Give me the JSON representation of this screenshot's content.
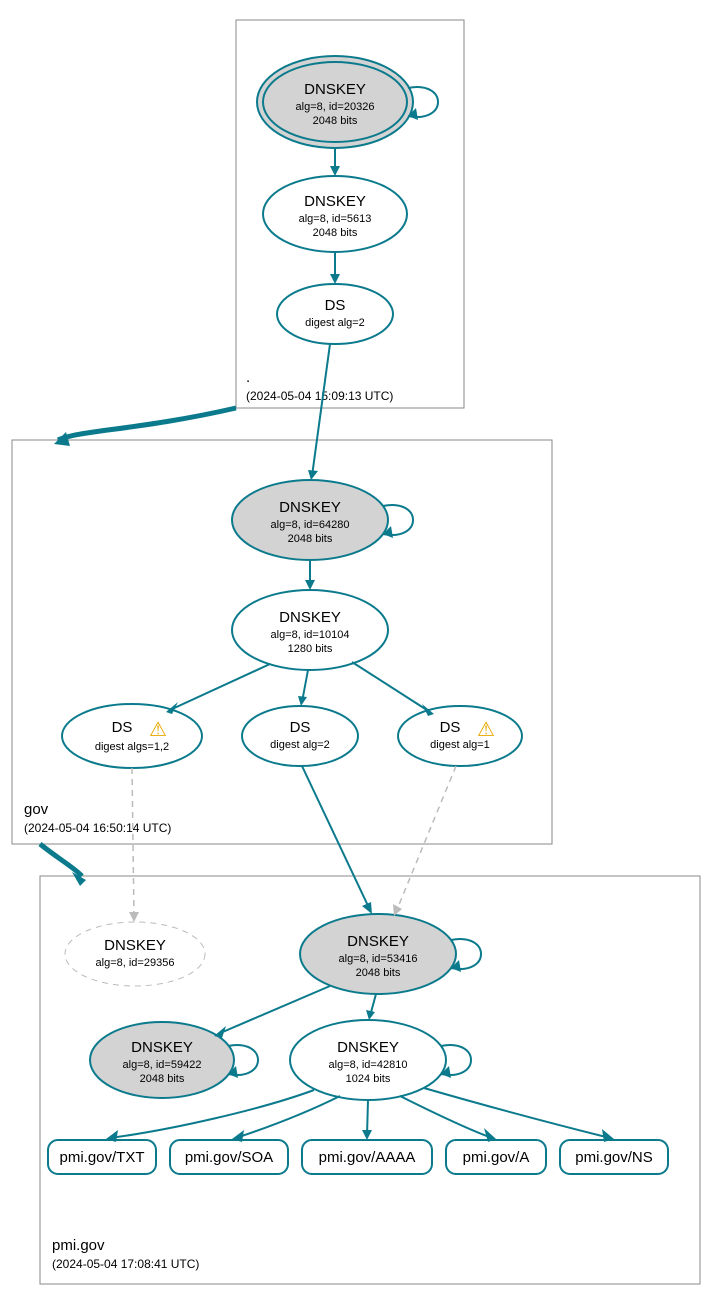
{
  "zones": {
    "root": {
      "label": ".",
      "timestamp": "(2024-05-04 15:09:13 UTC)",
      "ksk": {
        "title": "DNSKEY",
        "sub1": "alg=8, id=20326",
        "sub2": "2048 bits"
      },
      "zsk": {
        "title": "DNSKEY",
        "sub1": "alg=8, id=5613",
        "sub2": "2048 bits"
      },
      "ds": {
        "title": "DS",
        "sub1": "digest alg=2"
      }
    },
    "gov": {
      "label": "gov",
      "timestamp": "(2024-05-04 16:50:14 UTC)",
      "ksk": {
        "title": "DNSKEY",
        "sub1": "alg=8, id=64280",
        "sub2": "2048 bits"
      },
      "zsk": {
        "title": "DNSKEY",
        "sub1": "alg=8, id=10104",
        "sub2": "1280 bits"
      },
      "ds1": {
        "title": "DS",
        "sub1": "digest algs=1,2"
      },
      "ds2": {
        "title": "DS",
        "sub1": "digest alg=2"
      },
      "ds3": {
        "title": "DS",
        "sub1": "digest alg=1"
      }
    },
    "pmi": {
      "label": "pmi.gov",
      "timestamp": "(2024-05-04 17:08:41 UTC)",
      "missing": {
        "title": "DNSKEY",
        "sub1": "alg=8, id=29356"
      },
      "ksk": {
        "title": "DNSKEY",
        "sub1": "alg=8, id=53416",
        "sub2": "2048 bits"
      },
      "key2": {
        "title": "DNSKEY",
        "sub1": "alg=8, id=59422",
        "sub2": "2048 bits"
      },
      "zsk": {
        "title": "DNSKEY",
        "sub1": "alg=8, id=42810",
        "sub2": "1024 bits"
      },
      "rrsets": {
        "txt": "pmi.gov/TXT",
        "soa": "pmi.gov/SOA",
        "aaaa": "pmi.gov/AAAA",
        "a": "pmi.gov/A",
        "ns": "pmi.gov/NS"
      }
    }
  },
  "icons": {
    "warning": "⚠"
  }
}
